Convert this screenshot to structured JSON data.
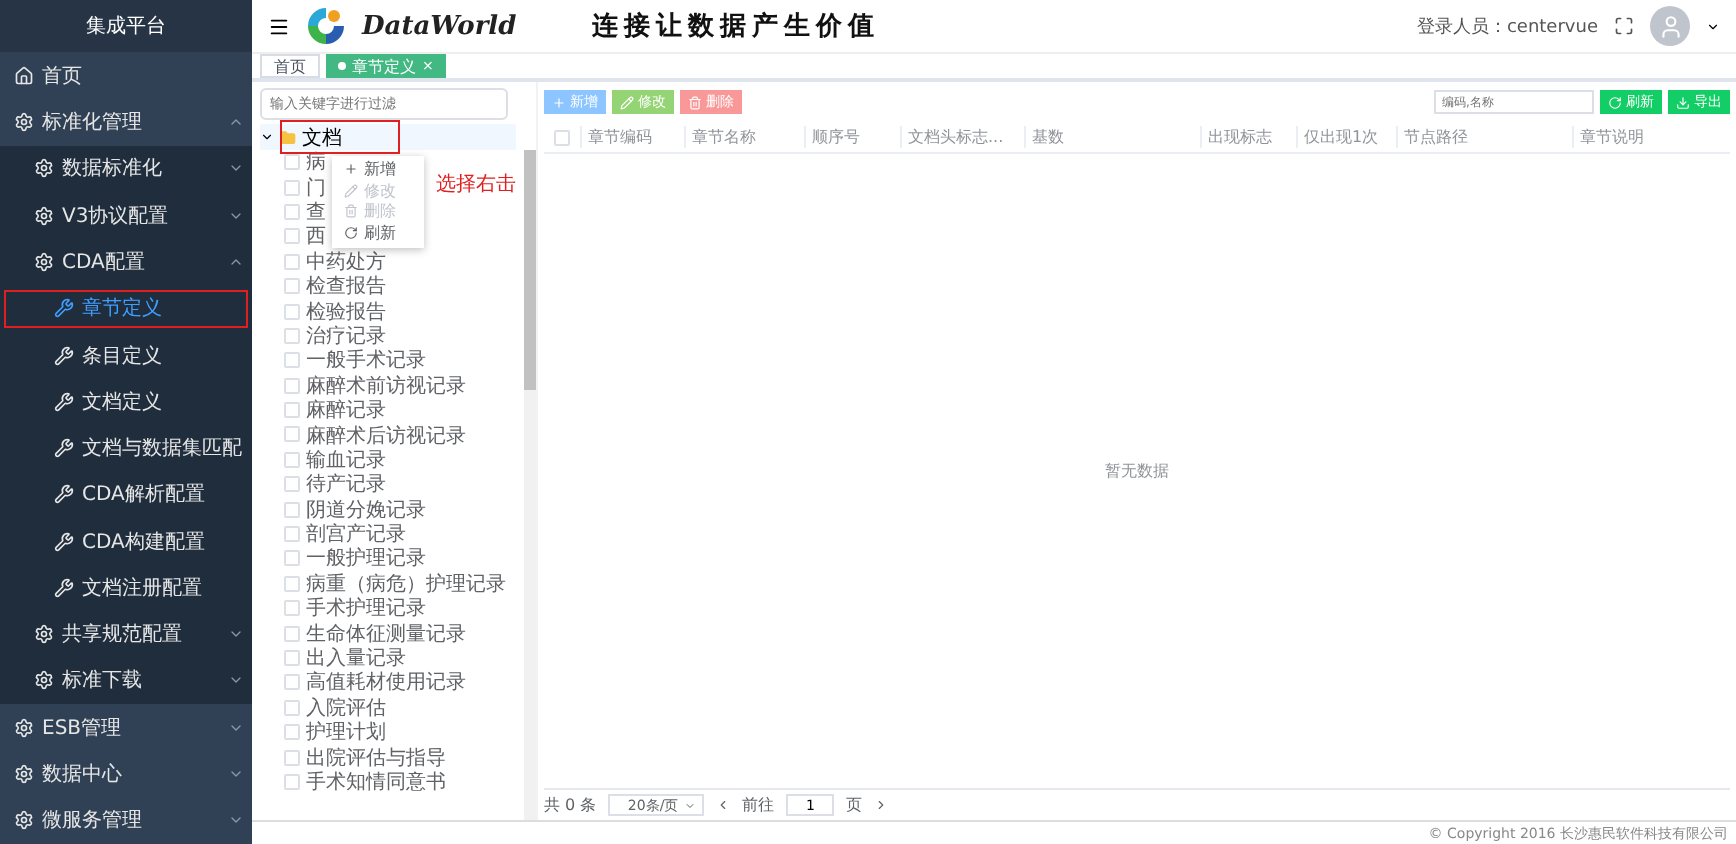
{
  "sidebar": {
    "title": "集成平台",
    "items": [
      {
        "label": "首页",
        "kind": "home",
        "selected": false
      },
      {
        "label": "标准化管理",
        "kind": "group",
        "expanded": true,
        "selected": false,
        "children": [
          {
            "label": "数据标准化",
            "kind": "group",
            "expanded": false,
            "selected": false
          },
          {
            "label": "V3协议配置",
            "kind": "group",
            "expanded": false,
            "selected": false
          },
          {
            "label": "CDA配置",
            "kind": "group",
            "expanded": true,
            "selected": false,
            "children": [
              {
                "label": "章节定义",
                "kind": "tool",
                "selected": true
              },
              {
                "label": "条目定义",
                "kind": "tool",
                "selected": false
              },
              {
                "label": "文档定义",
                "kind": "tool",
                "selected": false
              },
              {
                "label": "文档与数据集匹配",
                "kind": "tool",
                "selected": false
              },
              {
                "label": "CDA解析配置",
                "kind": "tool",
                "selected": false
              },
              {
                "label": "CDA构建配置",
                "kind": "tool",
                "selected": false
              },
              {
                "label": "文档注册配置",
                "kind": "tool",
                "selected": false
              }
            ]
          },
          {
            "label": "共享规范配置",
            "kind": "group",
            "expanded": false,
            "selected": false
          },
          {
            "label": "标准下载",
            "kind": "group",
            "expanded": false,
            "selected": false
          }
        ]
      },
      {
        "label": "ESB管理",
        "kind": "group",
        "expanded": false,
        "selected": false
      },
      {
        "label": "数据中心",
        "kind": "group",
        "expanded": false,
        "selected": false
      },
      {
        "label": "微服务管理",
        "kind": "group",
        "expanded": false,
        "selected": false
      }
    ]
  },
  "header": {
    "logo": "DataWorld",
    "slogan": "连接让数据产生价值",
    "user": "登录人员：centervue"
  },
  "tabs": [
    {
      "label": "首页",
      "selected": false
    },
    {
      "label": "章节定义",
      "selected": true,
      "close": "×"
    }
  ],
  "tree": {
    "search": {
      "placeholder": "输入关键字进行过滤"
    },
    "root": {
      "label": "文档",
      "expanded": true
    },
    "items": [
      {
        "label": "病",
        "checked": false
      },
      {
        "label": "门",
        "checked": false
      },
      {
        "label": "查",
        "checked": false
      },
      {
        "label": "西",
        "checked": false
      },
      {
        "label": "中药处方",
        "checked": false
      },
      {
        "label": "检查报告",
        "checked": false
      },
      {
        "label": "检验报告",
        "checked": false
      },
      {
        "label": "治疗记录",
        "checked": false
      },
      {
        "label": "一般手术记录",
        "checked": false
      },
      {
        "label": "麻醉术前访视记录",
        "checked": false
      },
      {
        "label": "麻醉记录",
        "checked": false
      },
      {
        "label": "麻醉术后访视记录",
        "checked": false
      },
      {
        "label": "输血记录",
        "checked": false
      },
      {
        "label": "待产记录",
        "checked": false
      },
      {
        "label": "阴道分娩记录",
        "checked": false
      },
      {
        "label": "剖宫产记录",
        "checked": false
      },
      {
        "label": "一般护理记录",
        "checked": false
      },
      {
        "label": "病重（病危）护理记录",
        "checked": false
      },
      {
        "label": "手术护理记录",
        "checked": false
      },
      {
        "label": "生命体征测量记录",
        "checked": false
      },
      {
        "label": "出入量记录",
        "checked": false
      },
      {
        "label": "高值耗材使用记录",
        "checked": false
      },
      {
        "label": "入院评估",
        "checked": false
      },
      {
        "label": "护理计划",
        "checked": false
      },
      {
        "label": "出院评估与指导",
        "checked": false
      },
      {
        "label": "手术知情同意书",
        "checked": false
      }
    ],
    "context_menu": [
      {
        "label": "新增",
        "kind": "add",
        "disabled": false
      },
      {
        "label": "修改",
        "kind": "edit",
        "disabled": true
      },
      {
        "label": "删除",
        "kind": "delete",
        "disabled": true
      },
      {
        "label": "刷新",
        "kind": "refresh",
        "disabled": false
      }
    ],
    "annotation": "选择右击"
  },
  "toolbar": {
    "buttons": [
      {
        "label": "新增",
        "kind": "add"
      },
      {
        "label": "修改",
        "kind": "edit"
      },
      {
        "label": "删除",
        "kind": "delete"
      }
    ],
    "search": {
      "placeholder": "编码,名称"
    },
    "actions": [
      {
        "label": "刷新",
        "kind": "refresh"
      },
      {
        "label": "导出",
        "kind": "export"
      }
    ]
  },
  "table": {
    "select_all_checked": false,
    "columns": [
      "章节编码",
      "章节名称",
      "顺序号",
      "文档头标志...",
      "基数",
      "出现标志",
      "仅出现1次",
      "节点路径",
      "章节说明"
    ],
    "empty": "暂无数据"
  },
  "pagination": {
    "total": "共 0 条",
    "page_size": "20条/页",
    "goto": "前往",
    "page": "1",
    "page_unit": "页"
  },
  "footer": "© Copyright 2016 长沙惠民软件科技有限公司"
}
